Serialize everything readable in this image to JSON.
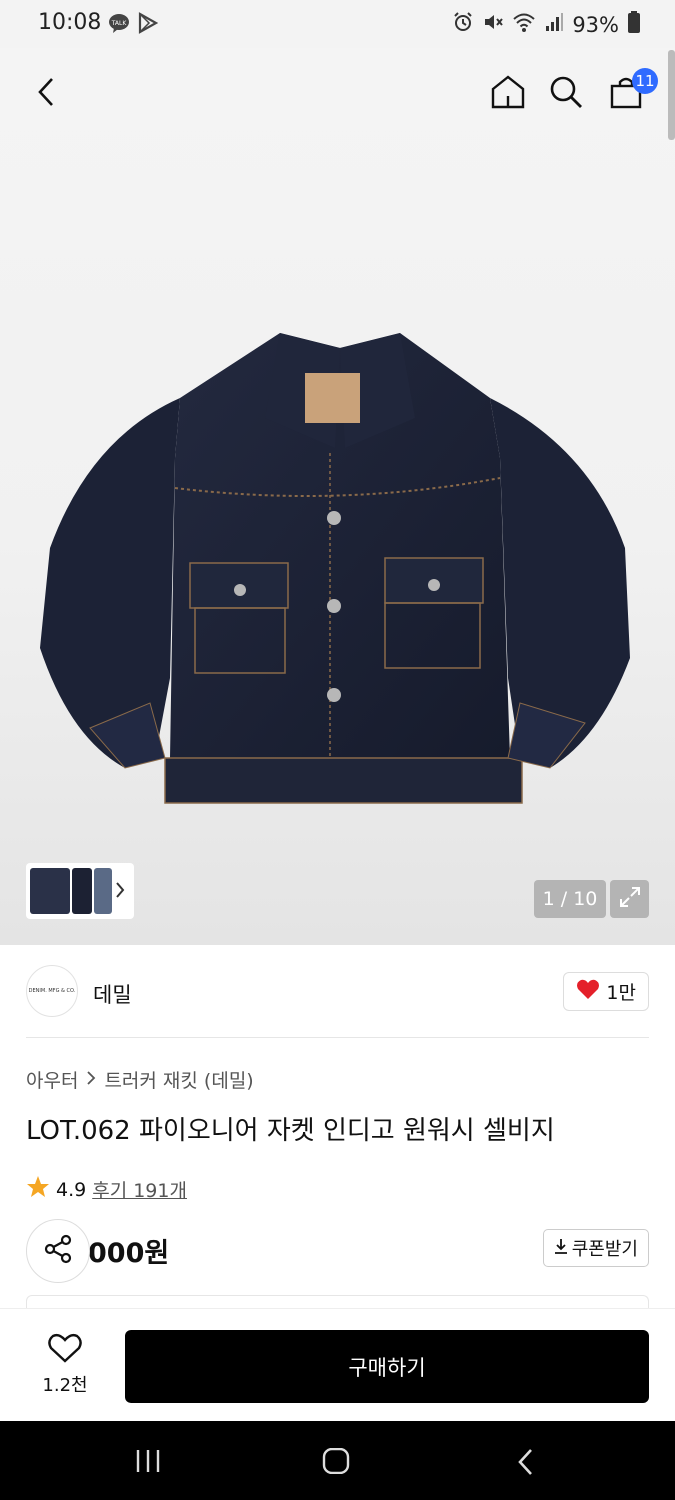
{
  "status_bar": {
    "time": "10:08",
    "battery": "93%",
    "left_icons": [
      "talk-icon",
      "play-icon"
    ],
    "right_icons": [
      "alarm-icon",
      "mute-icon",
      "wifi-icon",
      "signal-icon",
      "battery-icon"
    ]
  },
  "top_nav": {
    "back_icon": "back-arrow-icon",
    "home_icon": "home-icon",
    "search_icon": "search-icon",
    "cart_icon": "cart-icon",
    "cart_count": "11"
  },
  "gallery": {
    "page_counter": "1 / 10",
    "thumbnail_count": 3
  },
  "brand": {
    "logo_text": "DENIM. MFG & CO.",
    "name": "데밀",
    "like_count": "1만"
  },
  "product": {
    "breadcrumb": [
      "아우터",
      "트러커 재킷 (데밀)"
    ],
    "title": "LOT.062 파이오니어 자켓 인디고 원워시 셀비지",
    "rating": "4.9",
    "reviews": "후기 191개",
    "price": "000원",
    "coupon_label": "쿠폰받기"
  },
  "bottom_bar": {
    "wish_count": "1.2천",
    "buy_label": "구매하기"
  },
  "colors": {
    "accent_blue": "#2f6bff",
    "star": "#f5a623",
    "heart": "#e4202a",
    "denim": "#1b2238"
  }
}
